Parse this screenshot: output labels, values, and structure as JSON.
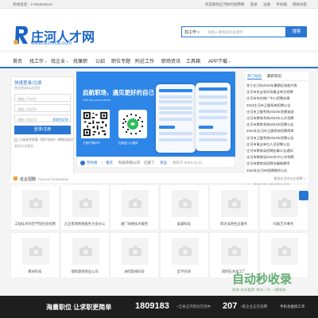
{
  "topbar": {
    "hotline": "热线电话：17553845110",
    "links": [
      "欢迎来到庄河你的招聘网",
      "登录",
      "注册",
      "手机端",
      "网站导航"
    ]
  },
  "logo": {
    "name": "庄河人才网",
    "url": "www.dlzhrcw.com"
  },
  "search": {
    "select": "找工作",
    "placeholder": "请输入要搜索的关键字",
    "button": "搜索"
  },
  "nav": [
    "首页",
    "找工作",
    "找企业",
    "找兼职",
    "公招",
    "职位专题",
    "附近工作",
    "职场资讯",
    "工具箱",
    "APP下载"
  ],
  "login": {
    "title": "快速登录/注册",
    "subtitle": "首次登录自动注册",
    "phone_placeholder": "请输入手机号",
    "code_placeholder": "请输入验证码",
    "code_button": "获取验证码",
    "login_button": "登录/注册",
    "agree": "已阅读并同意《用户协议》《隐私协议》",
    "other": "其他方式登录"
  },
  "banner": {
    "title": "启航职场，遇见更好的自己",
    "subtitle": "Sail into your career",
    "qr1_caption": "扫码下载APP",
    "qr2_caption": "扫码进入小程序",
    "foot_user": "罗利君",
    "foot_sep": "|",
    "foot_city": "重庆",
    "foot_co": "科技有限公司",
    "foot_action": "已发了",
    "foot_tag": "发运",
    "foot_date": "发布于 2024-12-21"
  },
  "news": {
    "tabs": [
      "热门动态",
      "最新资讯"
    ],
    "items": [
      "关于庄河市2024年属期区效能代表",
      "庄河市农业农村局事业单位招聘",
      "庄河市农技推广中心招聘启事",
      "2024庄河市卫健系统招聘公告",
      "庄河市卫健系统2024年急需紧缺",
      "庄河市教育系统2024年公开招聘",
      "庄河市教育系统2024年招聘公告",
      "2024年庄河市卫健系统招聘简章",
      "庄河市卫健系统2024年招聘公告",
      "庄河市事业单位人员招聘公告",
      "庄河市教育局招聘启事公告通知",
      "庄河市教育局2024年中小学招聘",
      "庄河市教育局招聘非编制教师",
      "2024年庄河市招聘教师公告",
      "关于庄河市人大常委会公开选",
      "关于公务员报考体检复检公告"
    ]
  },
  "enterprise": {
    "title": "名企招聘",
    "subtitle": "Famous Enterprise",
    "more": "更多庄河市名企招聘 >",
    "row1": [
      "工程技术师范学院社会招聘",
      "方正香港网络服务大会分公",
      "通广网络技术服务",
      "泰豪科技",
      "新达海港生态服务",
      "玛珈艺术事务"
    ],
    "row2": [
      "鹰卓科技",
      "瑞晖建材商业公司",
      "洲际影视科技",
      "宏宇农场",
      "南明石木加工厂",
      ""
    ]
  },
  "footer": {
    "tag": "海量职位 让求职更简单",
    "count1": "1809183",
    "label1": "+全省庄河岗位在招中",
    "count2": "207",
    "label2": "+家企业正在招聘",
    "app": "手机也能找工作"
  },
  "watermark": {
    "text": "自动秒收录",
    "sub": "收录·站长推荐·来访一次·一键收录"
  },
  "colors": {
    "brand": "#2a76d2",
    "banner": "#2e86e8",
    "footer": "#1e1e1e",
    "login_btn": "#2a76d2"
  }
}
